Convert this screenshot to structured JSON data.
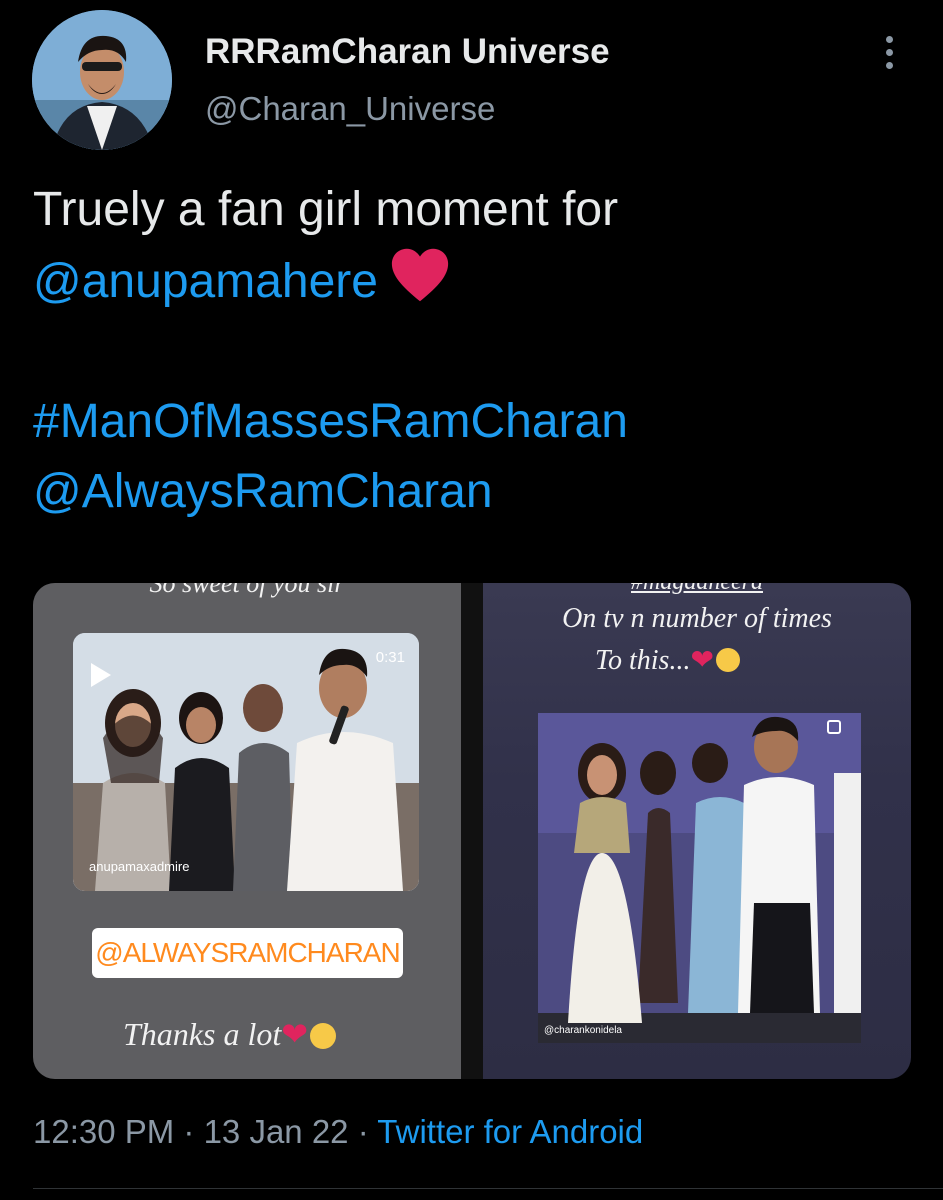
{
  "user": {
    "display_name": "RRRamCharan Universe",
    "handle": "@Charan_Universe"
  },
  "tweet": {
    "line1": "Truely a fan girl moment for",
    "mention1": "@anupamahere",
    "hashtag": "#ManOfMassesRamCharan",
    "mention2": "@AlwaysRamCharan"
  },
  "media": {
    "left": {
      "top_caption": "So sweet of you sir",
      "video_duration": "0:31",
      "video_watermark": "anupamaxadmire",
      "badge_text": "@ALWAYSRAMCHARAN",
      "bottom_caption": "Thanks a lot"
    },
    "right": {
      "top_caption": "#magadheera",
      "caption_line1": "On tv n number of times",
      "caption_line2": "To this...",
      "photo_watermark": "@charankonidela"
    }
  },
  "meta": {
    "time": "12:30 PM",
    "date": "13 Jan 22",
    "source": "Twitter for Android",
    "separator": " · "
  },
  "colors": {
    "background": "#000000",
    "text": "#e7e9ea",
    "muted": "#8b98a5",
    "link": "#1d9bf0",
    "heart": "#e0245e"
  },
  "icons": [
    "more-vertical-icon",
    "heart-emoji-icon",
    "play-icon",
    "pleading-face-emoji-icon",
    "multi-photo-icon"
  ]
}
